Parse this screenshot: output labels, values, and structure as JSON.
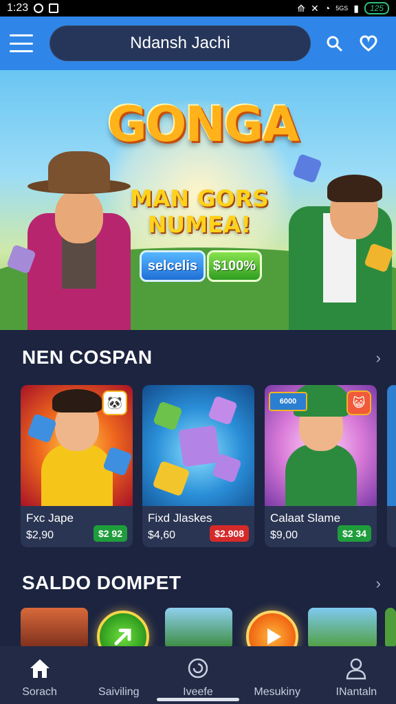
{
  "status_bar": {
    "time": "1:23",
    "battery": "125",
    "network": "5GS"
  },
  "header": {
    "title": "Ndansh Jachi"
  },
  "hero": {
    "logo": "GONGA",
    "slogan": "MAN GORS NUMEA!",
    "button_primary": "selcelis",
    "button_secondary": "$100%"
  },
  "section1": {
    "title": "NEN COSPAN"
  },
  "games": [
    {
      "name": "Fxc Jape",
      "price": "$2,90",
      "tag": "$2 92",
      "tag_color": "#1f9d3c"
    },
    {
      "name": "Fixd Jlaskes",
      "price": "$4,60",
      "tag": "$2.908",
      "tag_color": "#d42a2a"
    },
    {
      "name": "Calaat Slame",
      "price": "$9,00",
      "tag": "$2 34",
      "tag_color": "#1f9d3c"
    }
  ],
  "card3_badge": "6000",
  "section2": {
    "title": "SALDO DOMPET"
  },
  "nav": [
    {
      "label": "Sorach",
      "icon": "home-icon"
    },
    {
      "label": "Saiviling",
      "icon": "none"
    },
    {
      "label": "Iveefe",
      "icon": "refresh-icon"
    },
    {
      "label": "Mesukiny",
      "icon": "none"
    },
    {
      "label": "INantaln",
      "icon": "profile-icon"
    }
  ]
}
